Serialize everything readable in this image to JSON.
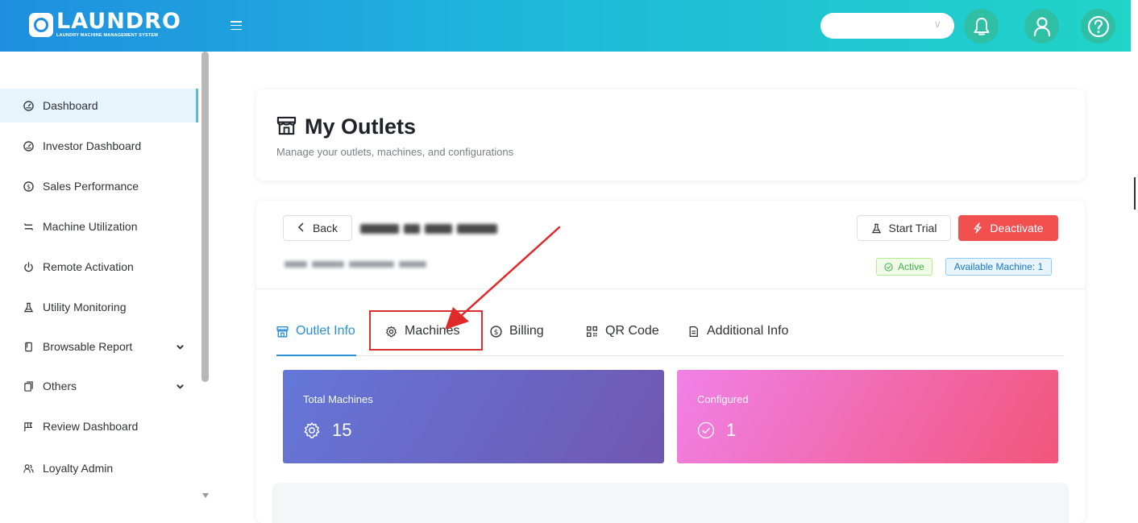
{
  "brand": {
    "name": "LAUNDRO",
    "tagline": "LAUNDRY MACHINE MANAGEMENT SYSTEM",
    "primary_gradient": [
      "#1f8ee0",
      "#20d4c8"
    ]
  },
  "header": {
    "select_value": "",
    "icons": [
      "menu-icon",
      "bell-icon",
      "user-icon",
      "help-icon"
    ]
  },
  "sidebar": {
    "items": [
      {
        "label": "Dashboard",
        "icon": "gauge-icon",
        "active": true
      },
      {
        "label": "Investor Dashboard",
        "icon": "gauge-icon"
      },
      {
        "label": "Sales Performance",
        "icon": "dollar-circle-icon"
      },
      {
        "label": "Machine Utilization",
        "icon": "swap-icon"
      },
      {
        "label": "Remote Activation",
        "icon": "power-icon"
      },
      {
        "label": "Utility Monitoring",
        "icon": "flask-icon"
      },
      {
        "label": "Browsable Report",
        "icon": "document-icon",
        "expandable": true
      },
      {
        "label": "Others",
        "icon": "copy-icon",
        "expandable": true
      },
      {
        "label": "Review Dashboard",
        "icon": "flag-icon"
      },
      {
        "label": "Loyalty Admin",
        "icon": "users-icon"
      }
    ]
  },
  "page": {
    "title": "My Outlets",
    "subtitle": "Manage your outlets, machines, and configurations"
  },
  "outlet": {
    "back_label": "Back",
    "start_trial_label": "Start Trial",
    "deactivate_label": "Deactivate",
    "status_label": "Active",
    "available_label": "Available Machine: 1",
    "status_color": "#3fae49",
    "deactivate_color": "#f24f4f"
  },
  "tabs": [
    {
      "label": "Outlet Info",
      "icon": "store-icon",
      "active": true
    },
    {
      "label": "Machines",
      "icon": "gear-icon"
    },
    {
      "label": "Billing",
      "icon": "dollar-circle-icon"
    },
    {
      "label": "QR Code",
      "icon": "qrcode-icon"
    },
    {
      "label": "Additional Info",
      "icon": "file-icon"
    }
  ],
  "stats": {
    "total_label": "Total Machines",
    "total_value": "15",
    "configured_label": "Configured",
    "configured_value": "1"
  },
  "annotation": {
    "highlight_target": "Machines",
    "color": "#d93030"
  }
}
